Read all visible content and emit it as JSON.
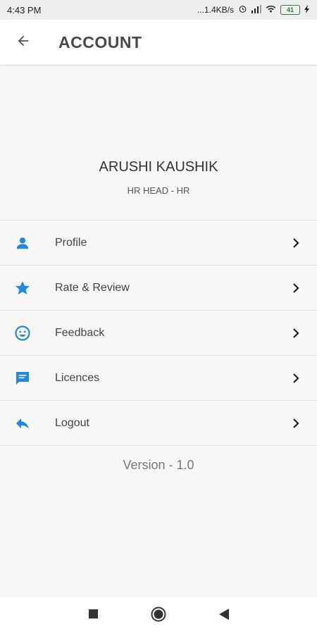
{
  "status_bar": {
    "time": "4:43 PM",
    "network_speed": "...1.4KB/s",
    "battery_level": "41"
  },
  "app_bar": {
    "title": "ACCOUNT"
  },
  "profile": {
    "name": "ARUSHI KAUSHIK",
    "role": "HR HEAD - HR"
  },
  "menu": {
    "items": [
      {
        "label": "Profile",
        "icon": "person-icon"
      },
      {
        "label": "Rate & Review",
        "icon": "star-icon"
      },
      {
        "label": "Feedback",
        "icon": "smiley-icon"
      },
      {
        "label": "Licences",
        "icon": "chat-bubble-icon"
      },
      {
        "label": "Logout",
        "icon": "reply-icon"
      }
    ]
  },
  "version_text": "Version - 1.0",
  "colors": {
    "accent": "#1e88e5",
    "battery": "#2e7d32"
  }
}
